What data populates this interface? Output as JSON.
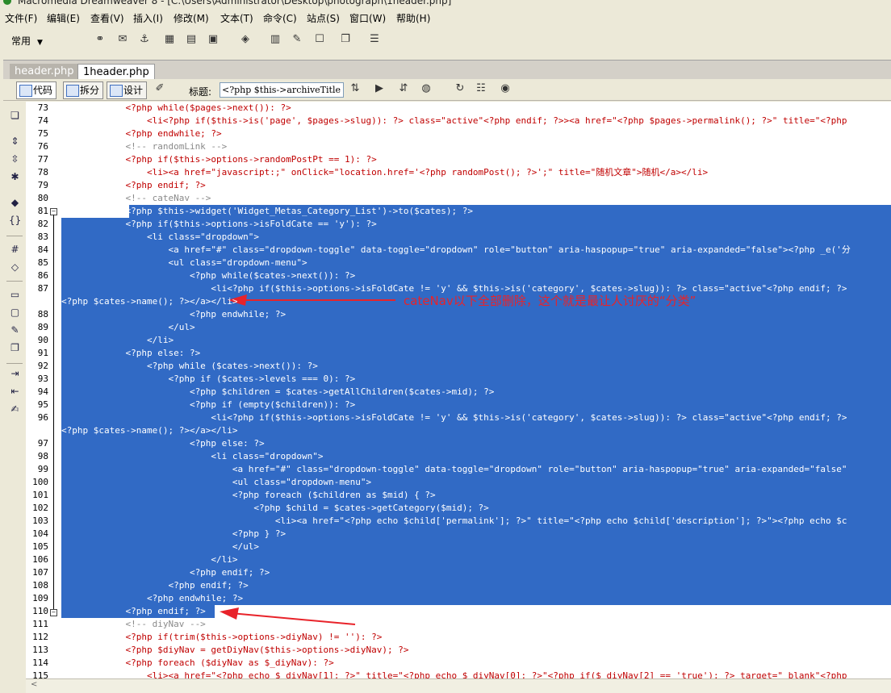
{
  "window": {
    "title": "Macromedia Dreamweaver 8 - [C:\\Users\\Administrator\\Desktop\\photograph\\1header.php]"
  },
  "menu": [
    "文件(F)",
    "编辑(E)",
    "查看(V)",
    "插入(I)",
    "修改(M)",
    "文本(T)",
    "命令(C)",
    "站点(S)",
    "窗口(W)",
    "帮助(H)"
  ],
  "toolbar": {
    "category": "常用"
  },
  "tabs": [
    {
      "label": "header.php"
    },
    {
      "label": "1header.php"
    }
  ],
  "doc_toolbar": {
    "code": "代码",
    "split": "拆分",
    "design": "设计",
    "title_label": "标题:",
    "title_value": "<?php $this->archiveTitle"
  },
  "annotation": {
    "text": "cateNav以下全部删除，这个就是最让人讨厌的“分类”"
  },
  "lines": [
    {
      "n": "73",
      "t": "            <?php while($pages->next()): ?>"
    },
    {
      "n": "74",
      "t": "                <li<?php if($this->is('page', $pages->slug)): ?> class=\"active\"<?php endif; ?>><a href=\"<?php $pages->permalink(); ?>\" title=\"<?php"
    },
    {
      "n": "75",
      "t": "            <?php endwhile; ?>"
    },
    {
      "n": "76",
      "t": "            <!-- randomLink -->"
    },
    {
      "n": "77",
      "t": "            <?php if($this->options->randomPostPt == 1): ?>"
    },
    {
      "n": "78",
      "t": "                <li><a href=\"javascript:;\" onClick=\"location.href='<?php randomPost(); ?>';\" title=\"随机文章\">随机</a></li>"
    },
    {
      "n": "79",
      "t": "            <?php endif; ?>"
    },
    {
      "n": "80",
      "t": "            <!-- cateNav -->"
    },
    {
      "n": "81",
      "t": "            <?php $this->widget('Widget_Metas_Category_List')->to($cates); ?>"
    },
    {
      "n": "82",
      "t": "            <?php if($this->options->isFoldCate == 'y'): ?>"
    },
    {
      "n": "83",
      "t": "                <li class=\"dropdown\">"
    },
    {
      "n": "84",
      "t": "                    <a href=\"#\" class=\"dropdown-toggle\" data-toggle=\"dropdown\" role=\"button\" aria-haspopup=\"true\" aria-expanded=\"false\"><?php _e('分"
    },
    {
      "n": "85",
      "t": "                    <ul class=\"dropdown-menu\">"
    },
    {
      "n": "86",
      "t": "                        <?php while($cates->next()): ?>"
    },
    {
      "n": "87",
      "t": "                            <li<?php if($this->options->isFoldCate != 'y' && $this->is('category', $cates->slug)): ?> class=\"active\"<?php endif; ?>"
    },
    {
      "n": "",
      "t": "<?php $cates->name(); ?></a></li>"
    },
    {
      "n": "88",
      "t": "                        <?php endwhile; ?>"
    },
    {
      "n": "89",
      "t": "                    </ul>"
    },
    {
      "n": "90",
      "t": "                </li>"
    },
    {
      "n": "91",
      "t": "            <?php else: ?>"
    },
    {
      "n": "92",
      "t": "                <?php while ($cates->next()): ?>"
    },
    {
      "n": "93",
      "t": "                    <?php if ($cates->levels === 0): ?>"
    },
    {
      "n": "94",
      "t": "                        <?php $children = $cates->getAllChildren($cates->mid); ?>"
    },
    {
      "n": "95",
      "t": "                        <?php if (empty($children)): ?>"
    },
    {
      "n": "96",
      "t": "                            <li<?php if($this->options->isFoldCate != 'y' && $this->is('category', $cates->slug)): ?> class=\"active\"<?php endif; ?>"
    },
    {
      "n": "",
      "t": "<?php $cates->name(); ?></a></li>"
    },
    {
      "n": "97",
      "t": "                        <?php else: ?>"
    },
    {
      "n": "98",
      "t": "                            <li class=\"dropdown\">"
    },
    {
      "n": "99",
      "t": "                                <a href=\"#\" class=\"dropdown-toggle\" data-toggle=\"dropdown\" role=\"button\" aria-haspopup=\"true\" aria-expanded=\"false\""
    },
    {
      "n": "100",
      "t": "                                <ul class=\"dropdown-menu\">"
    },
    {
      "n": "101",
      "t": "                                <?php foreach ($children as $mid) { ?>"
    },
    {
      "n": "102",
      "t": "                                    <?php $child = $cates->getCategory($mid); ?>"
    },
    {
      "n": "103",
      "t": "                                        <li><a href=\"<?php echo $child['permalink']; ?>\" title=\"<?php echo $child['description']; ?>\"><?php echo $c"
    },
    {
      "n": "104",
      "t": "                                <?php } ?>"
    },
    {
      "n": "105",
      "t": "                                </ul>"
    },
    {
      "n": "106",
      "t": "                            </li>"
    },
    {
      "n": "107",
      "t": "                        <?php endif; ?>"
    },
    {
      "n": "108",
      "t": "                    <?php endif; ?>"
    },
    {
      "n": "109",
      "t": "                <?php endwhile; ?>"
    },
    {
      "n": "110",
      "t": "            <?php endif; ?>"
    },
    {
      "n": "111",
      "t": "            <!-- diyNav -->"
    },
    {
      "n": "112",
      "t": "            <?php if(trim($this->options->diyNav) != ''): ?>"
    },
    {
      "n": "113",
      "t": "            <?php $diyNav = getDiyNav($this->options->diyNav); ?>"
    },
    {
      "n": "114",
      "t": "            <?php foreach ($diyNav as $_diyNav): ?>"
    },
    {
      "n": "115",
      "t": "                <li><a href=\"<?php echo $_diyNav[1]; ?>\" title=\"<?php echo $_diyNav[0]; ?>\"<?php if($_diyNav[2] == 'true'): ?> target=\"_blank\"<?php"
    }
  ],
  "selection": {
    "from_line": "81",
    "to_line": "110"
  },
  "colors": {
    "selection": "#316ac5",
    "php": "#c00000",
    "string": "#0000c0",
    "comment": "#8a8a8a",
    "annotation": "#e8232a"
  }
}
